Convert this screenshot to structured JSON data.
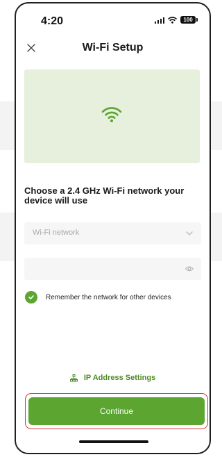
{
  "status_bar": {
    "time": "4:20",
    "battery": "100",
    "icons": [
      "signal-icon",
      "wifi-icon",
      "battery-icon"
    ]
  },
  "header": {
    "title": "Wi-Fi Setup",
    "close_icon": "close-icon"
  },
  "hero": {
    "icon": "wifi-icon",
    "background_color": "#e6f0dc",
    "icon_color": "#5ba530"
  },
  "main": {
    "headline": "Choose a 2.4 GHz Wi-Fi network your device will use",
    "network_field": {
      "placeholder": "Wi-Fi network",
      "value": "",
      "icon": "chevron-down-icon"
    },
    "password_field": {
      "placeholder": "",
      "value": "",
      "icon": "eye-icon"
    },
    "remember": {
      "label": "Remember the network for other devices",
      "checked": true
    }
  },
  "footer": {
    "ip_link": "IP Address Settings",
    "ip_icon": "network-icon",
    "continue_label": "Continue"
  },
  "colors": {
    "accent": "#5ba530",
    "link": "#4d8a24",
    "highlight_outline": "#d03a3a"
  }
}
